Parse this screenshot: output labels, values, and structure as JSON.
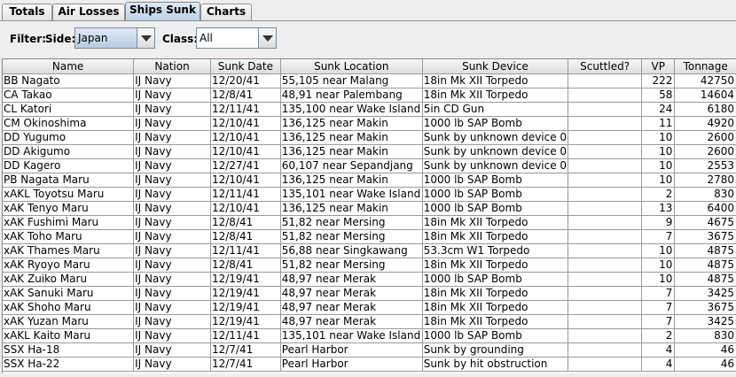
{
  "tabs": [
    {
      "label": "Totals"
    },
    {
      "label": "Air Losses"
    },
    {
      "label": "Ships Sunk"
    },
    {
      "label": "Charts"
    }
  ],
  "filter": {
    "label": "Filter:",
    "side_label": "Side:",
    "side_value": "Japan",
    "class_label": "Class:",
    "class_value": "All"
  },
  "table": {
    "columns": [
      "Name",
      "Nation",
      "Sunk Date",
      "Sunk Location",
      "Sunk Device",
      "Scuttled?",
      "VP",
      "Tonnage"
    ],
    "rows": [
      [
        "BB Nagato",
        "IJ Navy",
        "12/20/41",
        "55,105 near Malang",
        "18in Mk XII Torpedo",
        "",
        "222",
        "42750"
      ],
      [
        "CA Takao",
        "IJ Navy",
        "12/8/41",
        "48,91 near Palembang",
        "18in Mk XII Torpedo",
        "",
        "58",
        "14604"
      ],
      [
        "CL Katori",
        "IJ Navy",
        "12/11/41",
        "135,100 near Wake Island",
        "5in CD Gun",
        "",
        "24",
        "6180"
      ],
      [
        "CM Okinoshima",
        "IJ Navy",
        "12/10/41",
        "136,125 near Makin",
        "1000 lb SAP Bomb",
        "",
        "11",
        "4920"
      ],
      [
        "DD Yugumo",
        "IJ Navy",
        "12/10/41",
        "136,125 near Makin",
        "Sunk by unknown device 0",
        "",
        "10",
        "2600"
      ],
      [
        "DD Akigumo",
        "IJ Navy",
        "12/10/41",
        "136,125 near Makin",
        "Sunk by unknown device 0",
        "",
        "10",
        "2600"
      ],
      [
        "DD Kagero",
        "IJ Navy",
        "12/27/41",
        "60,107 near Sepandjang",
        "Sunk by unknown device 0",
        "",
        "10",
        "2553"
      ],
      [
        "PB Nagata Maru",
        "IJ Navy",
        "12/10/41",
        "136,125 near Makin",
        "1000 lb SAP Bomb",
        "",
        "10",
        "2780"
      ],
      [
        "xAKL Toyotsu Maru",
        "IJ Navy",
        "12/11/41",
        "135,101 near Wake Island",
        "1000 lb SAP Bomb",
        "",
        "2",
        "830"
      ],
      [
        "xAK Tenyo Maru",
        "IJ Navy",
        "12/10/41",
        "136,125 near Makin",
        "1000 lb SAP Bomb",
        "",
        "13",
        "6400"
      ],
      [
        "xAK Fushimi Maru",
        "IJ Navy",
        "12/8/41",
        "51,82 near Mersing",
        "18in Mk XII Torpedo",
        "",
        "9",
        "4675"
      ],
      [
        "xAK Toho Maru",
        "IJ Navy",
        "12/8/41",
        "51,82 near Mersing",
        "18in Mk XII Torpedo",
        "",
        "7",
        "3675"
      ],
      [
        "xAK Thames Maru",
        "IJ Navy",
        "12/11/41",
        "56,88 near Singkawang",
        "53.3cm W1 Torpedo",
        "",
        "10",
        "4875"
      ],
      [
        "xAK Ryoyo Maru",
        "IJ Navy",
        "12/8/41",
        "51,82 near Mersing",
        "18in Mk XII Torpedo",
        "",
        "10",
        "4875"
      ],
      [
        "xAK Zuiko Maru",
        "IJ Navy",
        "12/19/41",
        "48,97 near Merak",
        "1000 lb SAP Bomb",
        "",
        "10",
        "4875"
      ],
      [
        "xAK Sanuki Maru",
        "IJ Navy",
        "12/19/41",
        "48,97 near Merak",
        "18in Mk XII Torpedo",
        "",
        "7",
        "3425"
      ],
      [
        "xAK Shoho Maru",
        "IJ Navy",
        "12/19/41",
        "48,97 near Merak",
        "18in Mk XII Torpedo",
        "",
        "7",
        "3675"
      ],
      [
        "xAK Yuzan Maru",
        "IJ Navy",
        "12/19/41",
        "48,97 near Merak",
        "18in Mk XII Torpedo",
        "",
        "7",
        "3425"
      ],
      [
        "xAKL Kaito Maru",
        "IJ Navy",
        "12/11/41",
        "135,101 near Wake Island",
        "1000 lb SAP Bomb",
        "",
        "2",
        "830"
      ],
      [
        "SSX Ha-18",
        "IJ Navy",
        "12/7/41",
        "Pearl Harbor",
        "Sunk by grounding",
        "",
        "4",
        "46"
      ],
      [
        "SSX Ha-22",
        "IJ Navy",
        "12/7/41",
        "Pearl Harbor",
        "Sunk by hit obstruction",
        "",
        "4",
        "46"
      ]
    ]
  }
}
